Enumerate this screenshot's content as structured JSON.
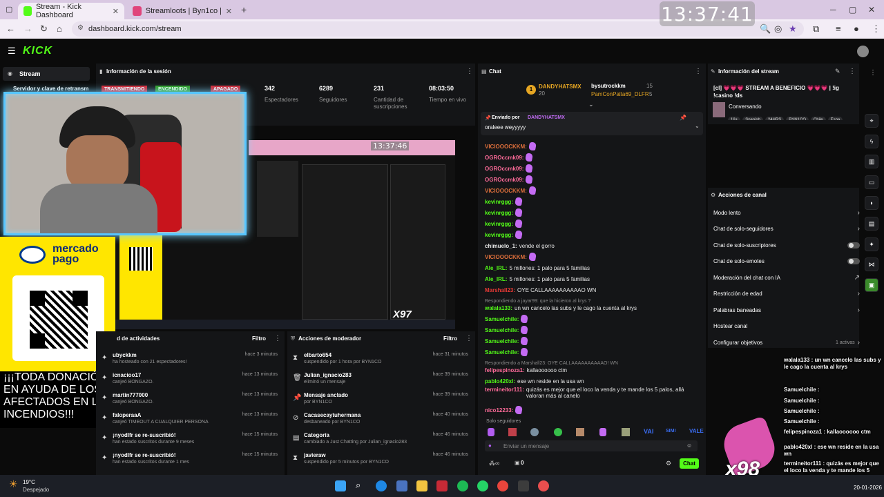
{
  "browser": {
    "tabs": [
      {
        "label": "Stream - Kick Dashboard",
        "active": true
      },
      {
        "label": "Streamloots | Byn1co | Apóyame",
        "active": false
      }
    ],
    "url": "dashboard.kick.com/stream"
  },
  "overlay_clock": "13:37:41",
  "mini_clock": "13:37:46",
  "left_nav": {
    "stream_label": "Stream",
    "server_key_label": "Servidor y clave de retransm"
  },
  "session": {
    "title": "Información de la sesión",
    "badges": [
      "TRANSMITIENDO",
      "ENCENDIDO",
      "APAGADO"
    ],
    "stats": [
      {
        "value": "342",
        "label": "Espectadores"
      },
      {
        "value": "6289",
        "label": "Seguidores"
      },
      {
        "value": "231",
        "label": "Cantidad de suscripciones"
      },
      {
        "value": "08:03:50",
        "label": "Tiempo en vivo"
      }
    ]
  },
  "activity": {
    "title": "d de actividades",
    "filter": "Filtro",
    "items": [
      {
        "title": "ubyckkm",
        "sub": "ha hosteado con 21 espectadores!",
        "time": "hace 3 minutos"
      },
      {
        "title": "icnacioo17",
        "sub": "canjeó BONGAZO.",
        "time": "hace 13 minutos"
      },
      {
        "title": "martin777000",
        "sub": "canjeó BONGAZO.",
        "time": "hace 13 minutos"
      },
      {
        "title": "faloperaaA",
        "sub": "canjeó TIMEOUT A CUALQUIER PERSONA",
        "time": "hace 13 minutos"
      },
      {
        "title": "¡nyodlfr se re-suscribió!",
        "sub": "han estado suscritos durante 9 meses",
        "time": "hace 15 minutos"
      },
      {
        "title": "¡nyodlfr se re-suscribió!",
        "sub": "han estado suscritos durante 1 mes",
        "time": "hace 15 minutos"
      }
    ]
  },
  "mod_actions": {
    "title": "Acciones de moderador",
    "filter": "Filtro",
    "items": [
      {
        "icon": "hourglass",
        "title": "elbarto654",
        "sub": "suspendido por 1 hora por BYN1CO",
        "time": "hace 31 minutos"
      },
      {
        "icon": "trash",
        "title": "Julian_ignacio283",
        "sub": "eliminó un mensaje",
        "time": "hace 39 minutos"
      },
      {
        "icon": "pin",
        "title": "Mensaje anclado",
        "sub": "por BYN1CO",
        "time": "hace 39 minutos"
      },
      {
        "icon": "ban",
        "title": "Cacasecaytuhermana",
        "sub": "desbaneado por BYN1CO",
        "time": "hace 40 minutos"
      },
      {
        "icon": "tag",
        "title": "Categoría",
        "sub": "cambiado a Just Chatting por Julian_ignacio283",
        "time": "hace 46 minutos"
      },
      {
        "icon": "hourglass",
        "title": "javieraw",
        "sub": "suspendido por 5 minutos por BYN1CO",
        "time": "hace 46 minutos"
      }
    ]
  },
  "chat": {
    "title": "Chat",
    "top_gifter": {
      "name": "DANDYHATSMX",
      "count": "20"
    },
    "gifters": [
      {
        "name": "bysutrockkm",
        "count": "15"
      },
      {
        "name": "PamConPalta69_DLFR",
        "count": "5"
      }
    ],
    "pinned": {
      "label": "Enviado por",
      "user": "DANDYHATSMX",
      "message": "oraleee weyyyyy"
    },
    "messages": [
      {
        "user": "VICIOOOCKKM:",
        "text": "",
        "color": "#e0703c"
      },
      {
        "user": "OGROccmk09:",
        "text": "",
        "color": "#ff6b9a"
      },
      {
        "user": "OGROccmk09:",
        "text": "",
        "color": "#ff6b9a"
      },
      {
        "user": "OGROccmk09:",
        "text": "",
        "color": "#ff6b9a"
      },
      {
        "user": "VICIOOOCKKM:",
        "text": "",
        "color": "#e0703c"
      },
      {
        "user": "kevinrggg:",
        "text": "",
        "color": "#53fc18"
      },
      {
        "user": "kevinrggg:",
        "text": "",
        "color": "#53fc18"
      },
      {
        "user": "kevinrggg:",
        "text": "",
        "color": "#53fc18"
      },
      {
        "user": "kevinrggg:",
        "text": "",
        "color": "#53fc18"
      },
      {
        "user": "chimuelo_1:",
        "text": "vende el gorro",
        "color": "#e8e8e8"
      },
      {
        "user": "VICIOOOCKKM:",
        "text": "",
        "color": "#e0703c"
      },
      {
        "user": "Ale_IRL:",
        "text": "5 millones: 1 palo para 5 familias",
        "color": "#53fc18"
      },
      {
        "user": "Ale_IRL:",
        "text": "5 millones: 1 palo para 5 familias",
        "color": "#53fc18"
      },
      {
        "user": "Marshall23:",
        "text": "OYE CALLAAAAAAAAAAO WN",
        "color": "#e53935"
      },
      {
        "user": "walala133:",
        "text": "un wn cancelo las subs y le cago la cuenta al krys",
        "color": "#53fc18"
      },
      {
        "user": "Samuelchile:",
        "text": "",
        "color": "#53fc18"
      },
      {
        "user": "Samuelchile:",
        "text": "",
        "color": "#53fc18"
      },
      {
        "user": "Samuelchile:",
        "text": "",
        "color": "#53fc18"
      },
      {
        "user": "Samuelchile:",
        "text": "",
        "color": "#53fc18"
      },
      {
        "user": "felipespinoza1:",
        "text": "kallaoooooo ctm",
        "color": "#ff6b9a"
      },
      {
        "user": "pablo420xl:",
        "text": "ese wn reside en la usa wn",
        "color": "#53fc18"
      },
      {
        "user": "termineitor111:",
        "text": "quizás es mejor que el loco la venda y te mande los 5 palos, allá valoran más al canelo",
        "color": "#ff6b9a"
      },
      {
        "user": "nico12233:",
        "text": "",
        "color": "#ff6b9a"
      }
    ],
    "reply1": "Respondiendo a jayar99: que la hicieron al krys ?",
    "reply2": "Respondiendo a Marshall23: OYE CALLAAAAAAAAAAO! WN",
    "mode": "Solo seguidores",
    "input_placeholder": "Enviar un mensaje",
    "counter": "0",
    "send_label": "Chat"
  },
  "stream_info": {
    "title": "Información del stream",
    "stream_title": "[cl] 💗💗💗 STREAM A BENEFICIO 💗💗💗 | !ig !casino !ds",
    "category": "Conversando",
    "tags": [
      "18+",
      "Spanish",
      "24HRS",
      "BYN1CO",
      "Chile",
      "Espa"
    ]
  },
  "channel_actions": {
    "title": "Acciones de canal",
    "items": [
      {
        "label": "Modo lento",
        "control": "chevron"
      },
      {
        "label": "Chat de solo-seguidores",
        "control": "chevron"
      },
      {
        "label": "Chat de solo-suscriptores",
        "control": "toggle"
      },
      {
        "label": "Chat de solo-emotes",
        "control": "toggle"
      },
      {
        "label": "Moderación del chat con IA",
        "control": "external"
      },
      {
        "label": "Restricción de edad",
        "control": "chevron"
      },
      {
        "label": "Palabras baneadas",
        "control": "chevron"
      },
      {
        "label": "Hostear canal",
        "control": "none"
      },
      {
        "label": "Configurar objetivos",
        "control": "chevron",
        "extra": "1 activas"
      }
    ]
  },
  "overlay": {
    "mercado_pago": "mercado pago",
    "donation": "¡¡¡TODA DONACIÓN EN AYUDA DE LOS AFECTADOS EN LOS INCENDIOS!!!",
    "x97": "X97",
    "x98": "x98",
    "chat_lines": [
      "walala133 : un wn cancelo las subs y le cago la cuenta al krys",
      "Samuelchile :",
      "Samuelchile :",
      "Samuelchile :",
      "Samuelchile :",
      "felipespinoza1 : kallaoooooo ctm",
      "pablo420xl : ese wn reside en la usa wn",
      "termineitor111 : quizás es mejor que el loco la venda y te mande los 5 palos, allá valoran más al canelo",
      "nico12233 :"
    ]
  },
  "taskbar": {
    "weather_temp": "19°C",
    "weather_desc": "Despejado",
    "date": "20-01-2026"
  }
}
